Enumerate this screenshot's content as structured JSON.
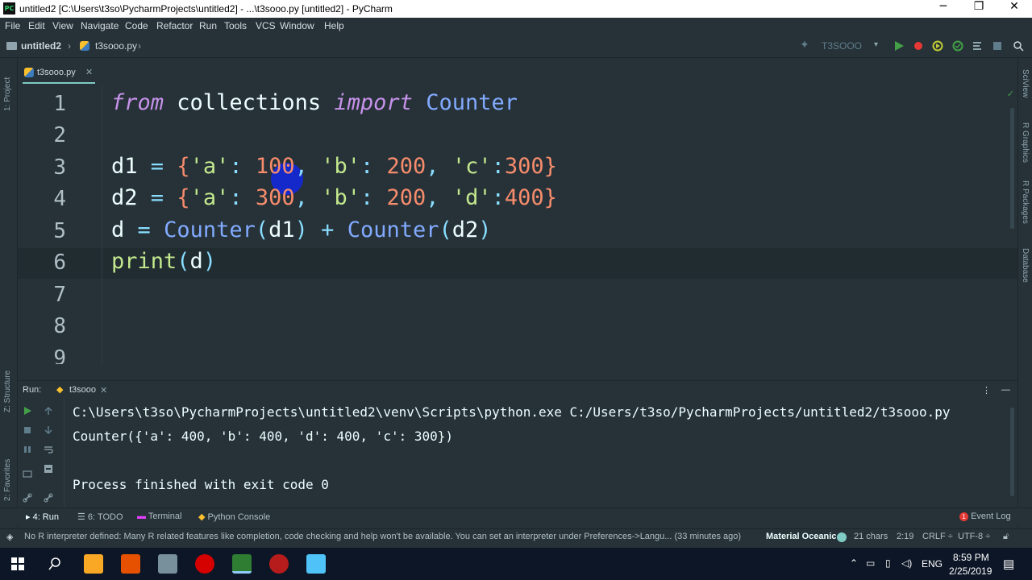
{
  "window": {
    "title": "untitled2 [C:\\Users\\t3so\\PycharmProjects\\untitled2] - ...\\t3sooo.py [untitled2] - PyCharm",
    "logo_text": "PC",
    "minimize": "─",
    "restore": "❐",
    "close": "✕"
  },
  "menu": [
    "File",
    "Edit",
    "View",
    "Navigate",
    "Code",
    "Refactor",
    "Run",
    "Tools",
    "VCS",
    "Window",
    "Help"
  ],
  "breadcrumb": {
    "project": "untitled2",
    "file": "t3sooo.py"
  },
  "run_config": {
    "name": "T3SOOO"
  },
  "left_strip": {
    "project": "1: Project",
    "structure": "Z: Structure",
    "favorites": "2: Favorites"
  },
  "right_strip": {
    "sciview": "SciView",
    "rgraphics": "R Graphics",
    "rpackages": "R Packages",
    "database": "Database"
  },
  "tab": {
    "label": "t3sooo.py",
    "close": "✕"
  },
  "editor": {
    "line_numbers": [
      "1",
      "2",
      "3",
      "4",
      "5",
      "6",
      "7",
      "8",
      "9"
    ],
    "lines": [
      "from collections import Counter",
      "",
      "d1 = {'a': 100, 'b': 200, 'c':300}",
      "d2 = {'a': 300, 'b': 200, 'd':400}",
      "d = Counter(d1) + Counter(d2)",
      "print(d)",
      "",
      "",
      ""
    ]
  },
  "run_panel": {
    "label": "Run:",
    "tab": "t3sooo",
    "output": [
      "C:\\Users\\t3so\\PycharmProjects\\untitled2\\venv\\Scripts\\python.exe C:/Users/t3so/PycharmProjects/untitled2/t3sooo.py",
      "Counter({'a': 400, 'b': 400, 'd': 400, 'c': 300})",
      "",
      "Process finished with exit code 0"
    ]
  },
  "tool_tabs": {
    "run": "4: Run",
    "todo": "6: TODO",
    "terminal": "Terminal",
    "console": "Python Console",
    "event_log": "Event Log",
    "event_count": "1"
  },
  "status_bar": {
    "message": "No R interpreter defined: Many R related features like completion, code checking and help won't be available. You can set an interpreter under Preferences->Langu... (33 minutes ago)",
    "theme": "Material Oceanic",
    "chars": "21 chars",
    "position": "2:19",
    "line_sep": "CRLF ÷",
    "encoding": "UTF-8 ÷"
  },
  "taskbar": {
    "lang": "ENG",
    "time": "8:59 PM",
    "date": "2/25/2019"
  },
  "colors": {
    "bg": "#263238",
    "keyword": "#c792ea",
    "function": "#82aaff",
    "number": "#f78c6c",
    "string": "#c3e88d"
  }
}
